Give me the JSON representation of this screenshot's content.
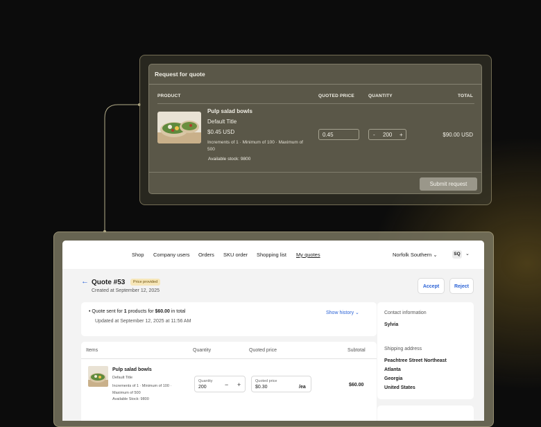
{
  "rfq": {
    "title": "Request for quote",
    "headers": {
      "product": "PRODUCT",
      "quoted_price": "QUOTED PRICE",
      "quantity": "QUANTITY",
      "total": "TOTAL"
    },
    "item": {
      "name": "Pulp salad bowls",
      "variant": "Default Title",
      "price": "$0.45 USD",
      "increments": "Increments of 1 · Minimum of 100 · Maximum of 500",
      "stock": "Available stock: 9800",
      "quoted_price_value": "0.45",
      "quantity": "200",
      "minus": "-",
      "plus": "+",
      "total": "$90.00 USD"
    },
    "submit_label": "Submit request"
  },
  "nav": {
    "items": [
      "Shop",
      "Company users",
      "Orders",
      "SKU order",
      "Shopping list",
      "My quotes"
    ],
    "company": "Norfolk Southern",
    "avatar": "SQ"
  },
  "quote": {
    "title": "Quote #53",
    "badge": "Price provided",
    "created": "Created at September 12, 2025",
    "accept_label": "Accept",
    "reject_label": "Reject",
    "sent_prefix": "Quote sent for ",
    "sent_count": "1",
    "sent_mid": " products for ",
    "sent_amount": "$60.00",
    "sent_suffix": " in total",
    "updated": "Updated at September 12, 2025 at 11:56 AM",
    "show_history": "Show history"
  },
  "items_table": {
    "headers": {
      "items": "Items",
      "quantity": "Quantity",
      "quoted_price": "Quoted price",
      "subtotal": "Subtotal"
    },
    "row": {
      "name": "Pulp salad bowls",
      "variant": "Default Title",
      "increments": "Increments of 1 · Minimum of 100 · Maximum of 500",
      "stock": "Available Stock: 9800",
      "quantity_label": "Quantity",
      "quantity": "200",
      "minus": "−",
      "plus": "+",
      "price_label": "Quoted price",
      "price": "$0.30",
      "unit": "/ea",
      "subtotal": "$60.00"
    }
  },
  "sidebar": {
    "contact_label": "Contact information",
    "contact_name": "Sylvia",
    "shipping_label": "Shipping address",
    "address": [
      "Peachtree Street Northeast",
      "Atlanta",
      "Georgia",
      "United States"
    ]
  },
  "colors": {
    "accent": "#2a62d6",
    "badge_bg": "#f6e6b8",
    "rfq_bg": "#5a5748"
  }
}
